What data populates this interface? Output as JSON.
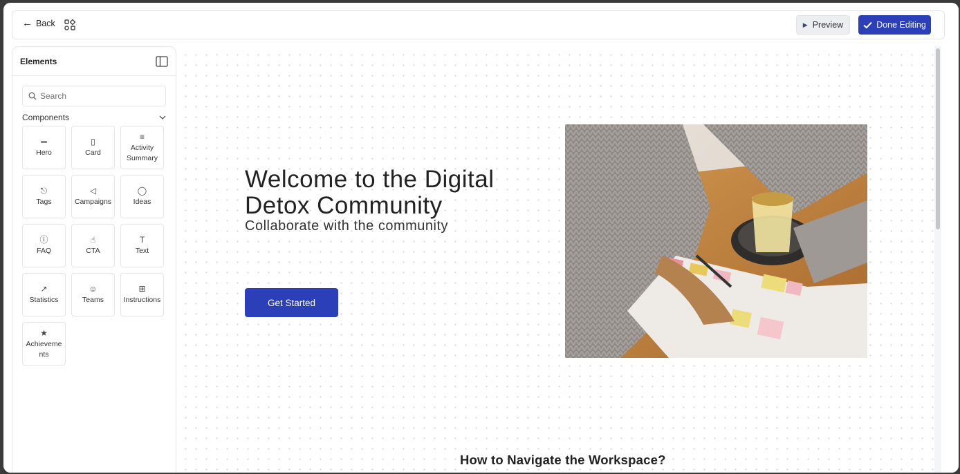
{
  "topbar": {
    "back_label": "Back",
    "preview_label": "Preview",
    "done_label": "Done Editing"
  },
  "sidebar": {
    "title": "Elements",
    "search_placeholder": "Search",
    "section_title": "Components",
    "components": [
      {
        "label": "Hero",
        "icon": "hero-icon"
      },
      {
        "label": "Card",
        "icon": "card-icon"
      },
      {
        "label": "Activity Summary",
        "icon": "list-icon"
      },
      {
        "label": "Tags",
        "icon": "tag-icon"
      },
      {
        "label": "Campaigns",
        "icon": "megaphone-icon"
      },
      {
        "label": "Ideas",
        "icon": "lightbulb-icon"
      },
      {
        "label": "FAQ",
        "icon": "question-icon"
      },
      {
        "label": "CTA",
        "icon": "pointer-icon"
      },
      {
        "label": "Text",
        "icon": "text-icon"
      },
      {
        "label": "Statistics",
        "icon": "trend-icon"
      },
      {
        "label": "Teams",
        "icon": "users-icon"
      },
      {
        "label": "Instructions",
        "icon": "grid-icon"
      },
      {
        "label": "Achieveme nts",
        "icon": "trophy-icon"
      }
    ]
  },
  "canvas": {
    "hero_title": "Welcome to the Digital Detox Community",
    "hero_subtitle": "Collaborate with the community",
    "cta_label": "Get Started",
    "next_heading": "How to Navigate the Workspace?"
  },
  "colors": {
    "accent": "#2b40b8"
  }
}
